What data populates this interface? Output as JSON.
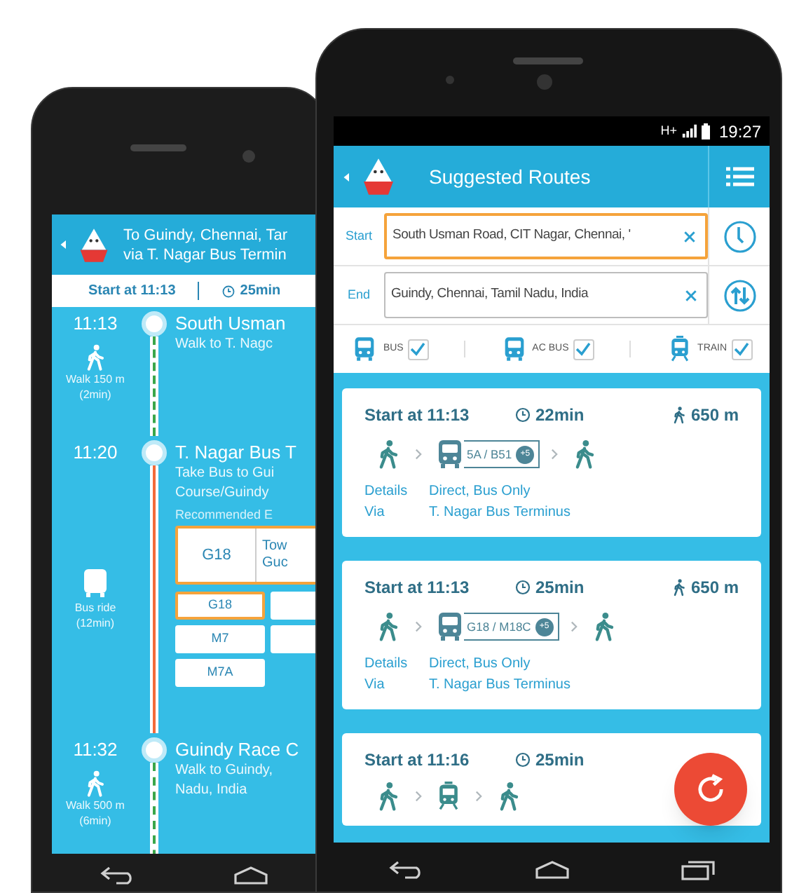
{
  "back_phone": {
    "header": {
      "destination": "To Guindy, Chennai, Tar",
      "via": "via T. Nagar Bus Termin"
    },
    "summary": {
      "start": "Start at 11:13",
      "duration": "25min"
    },
    "steps": [
      {
        "time": "11:13",
        "stop": "South Usman",
        "detail_lines": [
          "Walk to T. Nagc"
        ],
        "kind": "walk",
        "leg_lines": [
          "Walk 150 m",
          "(2min)"
        ]
      },
      {
        "time": "11:20",
        "stop": "T. Nagar Bus T",
        "detail_lines": [
          "Take Bus to Gui",
          "Course/Guindy"
        ],
        "kind": "bus",
        "leg_lines": [
          "Bus ride",
          "(12min)"
        ],
        "recommended_label": "Recommended E",
        "recommended": {
          "route": "G18",
          "destination_lines": [
            "Tow",
            "Guc"
          ]
        },
        "bus_options": [
          {
            "label": "G18",
            "selected": true
          },
          {
            "label": "M7",
            "selected": false
          },
          {
            "label": "M7A",
            "selected": false
          }
        ]
      },
      {
        "time": "11:32",
        "stop": "Guindy Race C",
        "detail_lines": [
          "Walk to Guindy,",
          "Nadu, India"
        ],
        "kind": "walk",
        "leg_lines": [
          "Walk 500 m",
          "(6min)"
        ]
      }
    ]
  },
  "front_phone": {
    "status_bar": {
      "network": "H+",
      "time": "19:27"
    },
    "header": {
      "title": "Suggested Routes"
    },
    "fields": [
      {
        "kind": "start",
        "label": "Start",
        "value": "South Usman Road, CIT Nagar, Chennai, '",
        "focused": true
      },
      {
        "kind": "end",
        "label": "End",
        "value": "Guindy, Chennai, Tamil Nadu, India",
        "focused": false
      }
    ],
    "modes": [
      {
        "kind": "bus",
        "label": "BUS",
        "checked": true
      },
      {
        "kind": "bus",
        "label": "AC BUS",
        "checked": true
      },
      {
        "kind": "train",
        "label": "TRAIN",
        "checked": true
      }
    ],
    "routes": [
      {
        "start": "Start at 11:13",
        "duration": "22min",
        "walk": "650 m",
        "legs": [
          {
            "kind": "walk"
          },
          {
            "kind": "bus",
            "label": "5A / B51",
            "extra": "+5"
          },
          {
            "kind": "walk"
          }
        ],
        "details_label": "Details",
        "details": "Direct, Bus Only",
        "via_label": "Via",
        "via": "T. Nagar Bus Terminus"
      },
      {
        "start": "Start at 11:13",
        "duration": "25min",
        "walk": "650 m",
        "legs": [
          {
            "kind": "walk"
          },
          {
            "kind": "bus",
            "label": "G18 / M18C",
            "extra": "+5"
          },
          {
            "kind": "walk"
          }
        ],
        "details_label": "Details",
        "details": "Direct, Bus Only",
        "via_label": "Via",
        "via": "T. Nagar Bus Terminus"
      },
      {
        "start": "Start at 11:16",
        "duration": "25min",
        "legs": [
          {
            "kind": "walk"
          },
          {
            "kind": "train"
          },
          {
            "kind": "walk"
          }
        ]
      }
    ]
  }
}
